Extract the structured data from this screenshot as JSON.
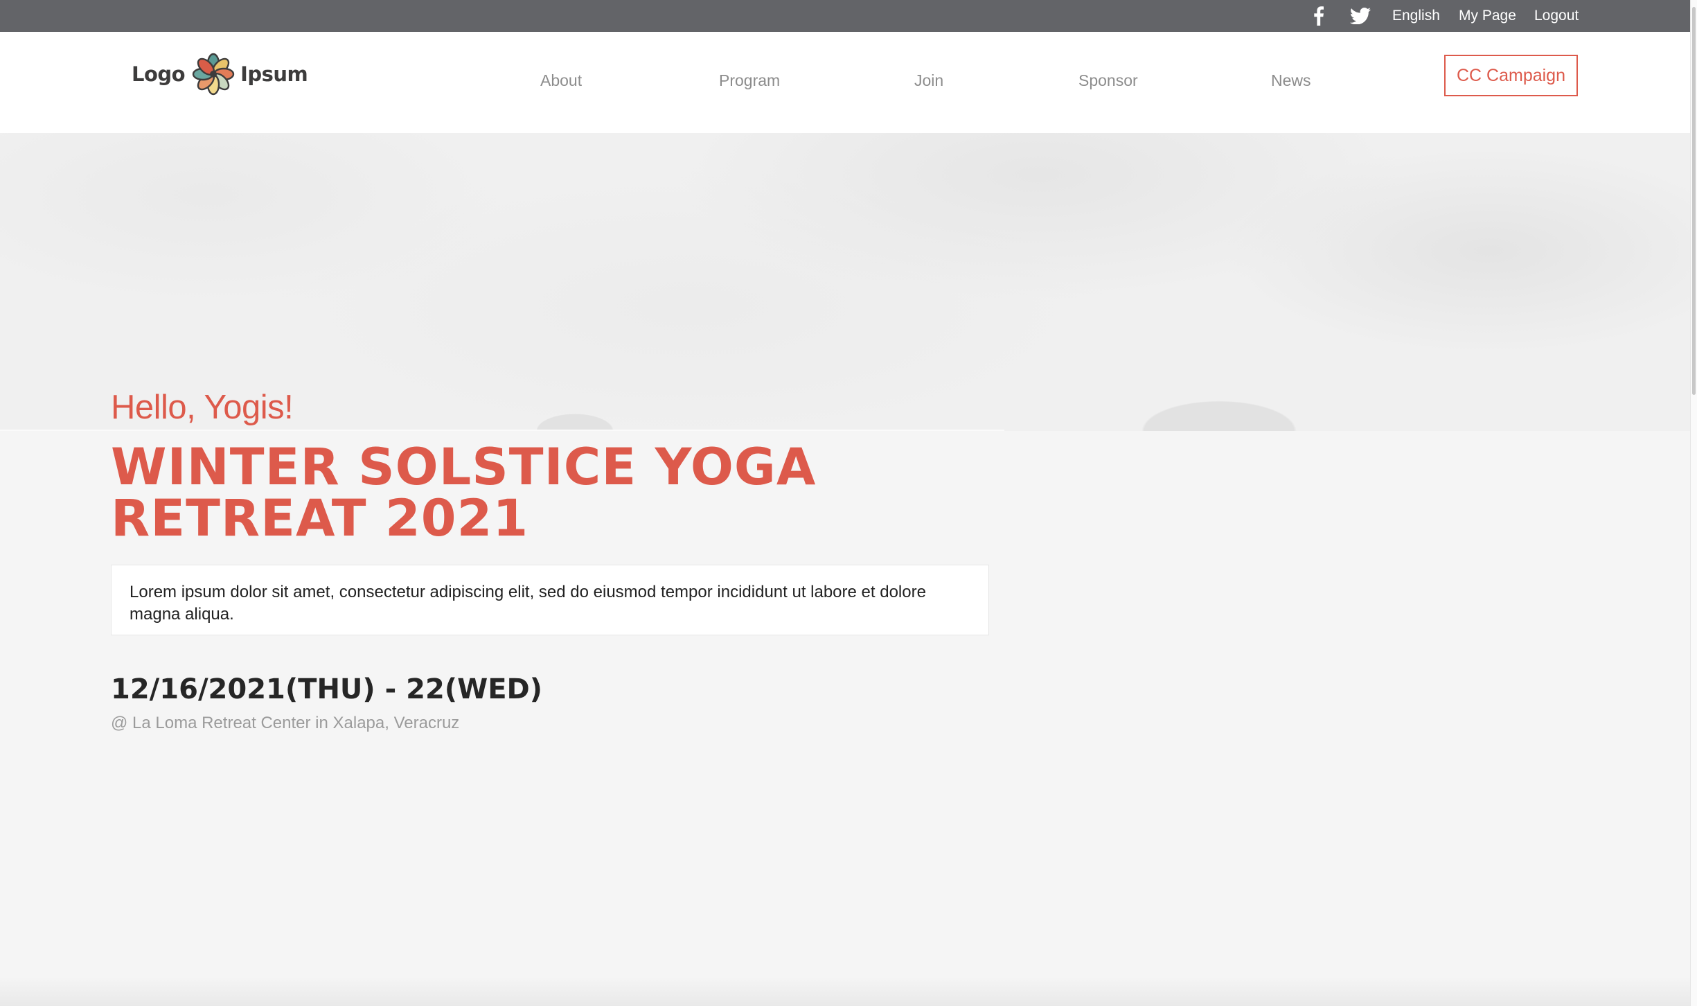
{
  "topbar": {
    "social": [
      {
        "icon": "facebook-icon"
      },
      {
        "icon": "twitter-icon"
      }
    ],
    "language": "English",
    "my_page": "My Page",
    "logout": "Logout"
  },
  "header": {
    "logo": {
      "left_word": "Logo",
      "right_word": "Ipsum"
    },
    "nav": [
      {
        "label": "About"
      },
      {
        "label": "Program"
      },
      {
        "label": "Join"
      },
      {
        "label": "Sponsor"
      },
      {
        "label": "News"
      }
    ],
    "cta_label": "CC Campaign"
  },
  "intro": {
    "greeting": "Hello, Yogis!",
    "title": "WINTER SOLSTICE YOGA RETREAT 2021",
    "description": "Lorem ipsum dolor sit amet, consectetur adipiscing elit, sed do eiusmod tempor incididunt ut labore et dolore magna aliqua.",
    "date": "12/16/2021(THU) - 22(WED)",
    "location": "@ La Loma Retreat Center in Xalapa, Veracruz"
  },
  "colors": {
    "accent": "#dd5a4b",
    "topbar_bg": "#636468",
    "nav_text": "#8c8c8c",
    "page_bg": "#f5f5f5"
  }
}
